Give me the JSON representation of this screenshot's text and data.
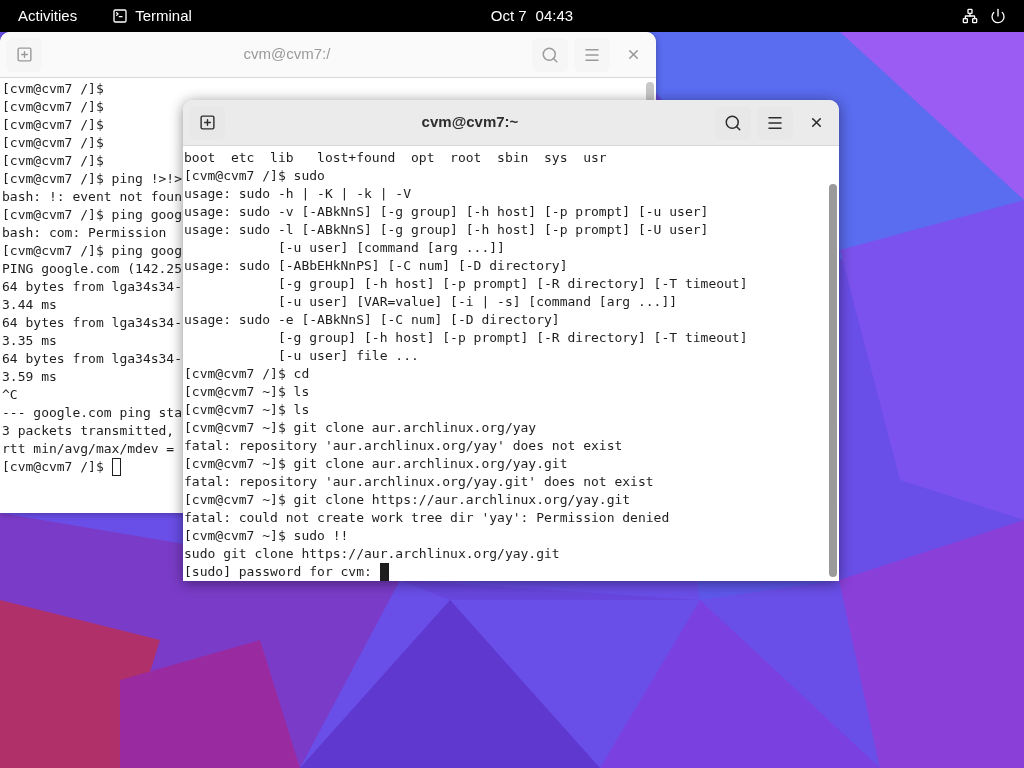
{
  "top_bar": {
    "activities": "Activities",
    "app": "Terminal",
    "date": "Oct 7",
    "time": "04:43"
  },
  "windows": [
    {
      "title": "cvm@cvm7:/",
      "focused": false,
      "lines": [
        "[cvm@cvm7 /]$",
        "[cvm@cvm7 /]$",
        "[cvm@cvm7 /]$",
        "[cvm@cvm7 /]$",
        "[cvm@cvm7 /]$",
        "[cvm@cvm7 /]$ ping !>!>",
        "bash: !: event not foun",
        "[cvm@cvm7 /]$ ping goog",
        "bash: com: Permission",
        "[cvm@cvm7 /]$ ping goog",
        "PING google.com (142.25",
        "64 bytes from lga34s34-",
        "3.44 ms",
        "64 bytes from lga34s34-",
        "3.35 ms",
        "64 bytes from lga34s34-",
        "3.59 ms",
        "^C",
        "--- google.com ping sta",
        "3 packets transmitted,",
        "rtt min/avg/max/mdev =",
        "[cvm@cvm7 /]$ "
      ]
    },
    {
      "title": "cvm@cvm7:~",
      "focused": true,
      "lines": [
        "boot  etc  lib   lost+found  opt  root  sbin  sys  usr",
        "[cvm@cvm7 /]$ sudo",
        "usage: sudo -h | -K | -k | -V",
        "usage: sudo -v [-ABkNnS] [-g group] [-h host] [-p prompt] [-u user]",
        "usage: sudo -l [-ABkNnS] [-g group] [-h host] [-p prompt] [-U user]",
        "            [-u user] [command [arg ...]]",
        "usage: sudo [-ABbEHkNnPS] [-C num] [-D directory]",
        "            [-g group] [-h host] [-p prompt] [-R directory] [-T timeout]",
        "            [-u user] [VAR=value] [-i | -s] [command [arg ...]]",
        "usage: sudo -e [-ABkNnS] [-C num] [-D directory]",
        "            [-g group] [-h host] [-p prompt] [-R directory] [-T timeout]",
        "            [-u user] file ...",
        "[cvm@cvm7 /]$ cd",
        "[cvm@cvm7 ~]$ ls",
        "[cvm@cvm7 ~]$ ls",
        "[cvm@cvm7 ~]$ git clone aur.archlinux.org/yay",
        "fatal: repository 'aur.archlinux.org/yay' does not exist",
        "[cvm@cvm7 ~]$ git clone aur.archlinux.org/yay.git",
        "fatal: repository 'aur.archlinux.org/yay.git' does not exist",
        "[cvm@cvm7 ~]$ git clone https://aur.archlinux.org/yay.git",
        "fatal: could not create work tree dir 'yay': Permission denied",
        "[cvm@cvm7 ~]$ sudo !!",
        "sudo git clone https://aur.archlinux.org/yay.git",
        "[sudo] password for cvm: "
      ]
    }
  ]
}
